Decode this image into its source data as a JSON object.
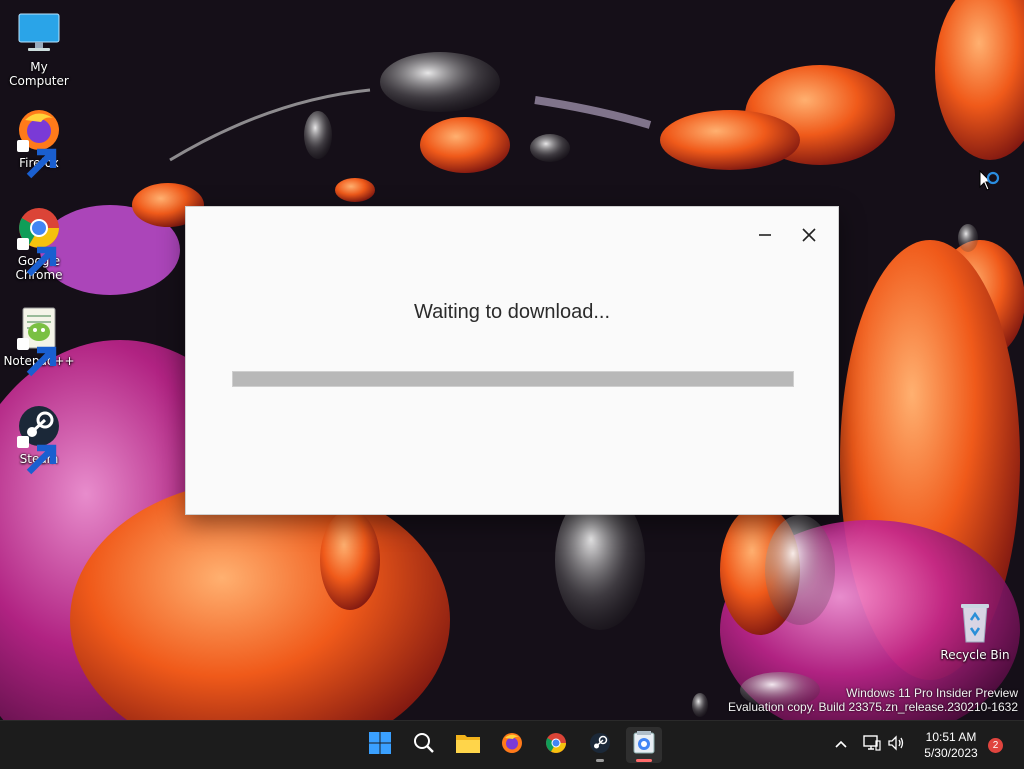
{
  "desktop": {
    "icons": [
      {
        "label": "My Computer",
        "icon": "monitor-icon"
      },
      {
        "label": "Firefox",
        "icon": "firefox-icon"
      },
      {
        "label": "Google Chrome",
        "icon": "chrome-icon"
      },
      {
        "label": "Notepad++",
        "icon": "notepadpp-icon"
      },
      {
        "label": "Steam",
        "icon": "steam-icon"
      },
      {
        "label": "Recycle Bin",
        "icon": "recycle-bin-icon"
      }
    ],
    "watermark": {
      "line1": "Windows 11 Pro Insider Preview",
      "line2": "Evaluation copy. Build 23375.zn_release.230210-1632"
    }
  },
  "dialog": {
    "status_text": "Waiting to download...",
    "progress_fraction": 0,
    "minimize_icon": "minimize-icon",
    "close_icon": "close-icon"
  },
  "taskbar": {
    "apps": [
      {
        "name": "Start",
        "icon": "windows-start-icon"
      },
      {
        "name": "Search",
        "icon": "search-icon"
      },
      {
        "name": "File Explorer",
        "icon": "folder-icon"
      },
      {
        "name": "Firefox",
        "icon": "firefox-icon"
      },
      {
        "name": "Google Chrome",
        "icon": "chrome-icon"
      },
      {
        "name": "Steam",
        "icon": "steam-icon"
      },
      {
        "name": "Installer",
        "icon": "installer-icon"
      }
    ],
    "tray": {
      "chevron_icon": "chevron-up-icon",
      "network_icon": "network-icon",
      "volume_icon": "volume-icon"
    },
    "clock": {
      "time": "10:51 AM",
      "date": "5/30/2023"
    },
    "notification_count": "2"
  },
  "colors": {
    "accent": "#0067c0",
    "notification_badge": "#e0443e",
    "progress_track": "#b8b8b8",
    "taskbar": "#1c1c1c"
  }
}
